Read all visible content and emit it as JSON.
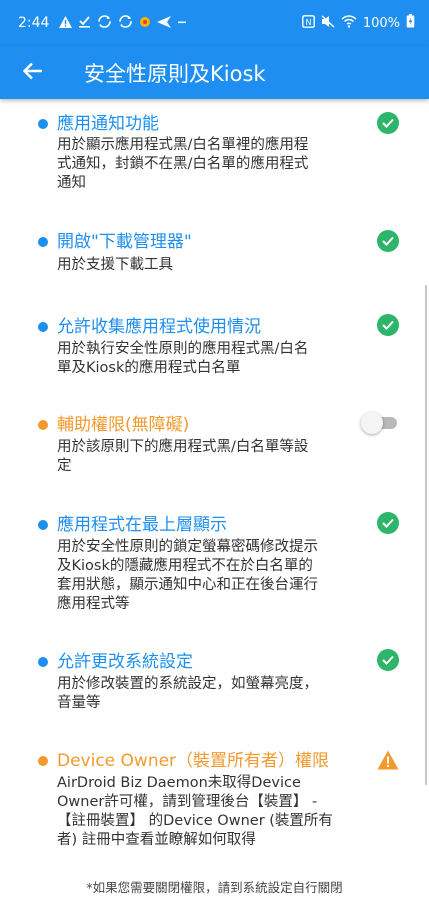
{
  "status_bar": {
    "time": "2:44",
    "battery": "100%",
    "left_icons": [
      "warning-icon",
      "download-done-icon",
      "sync-icon",
      "sync-icon",
      "app-notification-icon",
      "send-icon",
      "dash-icon"
    ],
    "right_icons": [
      "nfc-icon",
      "mute-icon",
      "wifi-icon",
      "battery-icon"
    ]
  },
  "app_bar": {
    "title": "安全性原則及Kiosk"
  },
  "colors": {
    "primary": "#1e8ff0",
    "success": "#2db56a",
    "warning": "#f39a2d",
    "toggle_off": "#b9b9b9"
  },
  "permissions": [
    {
      "title": "應用通知功能",
      "desc_lines": [
        "用於顯示應用程式黑/白名單裡的應用程",
        "式通知，封鎖不在黑/白名單的應用程式",
        "通知"
      ],
      "state": "granted",
      "color": "blue"
    },
    {
      "title": "開啟\"下載管理器\"",
      "desc_lines": [
        "用於支援下載工具"
      ],
      "state": "granted",
      "color": "blue"
    },
    {
      "title": "允許收集應用程式使用情況",
      "desc_lines": [
        "用於執行安全性原則的應用程式黑/白名",
        "單及Kiosk的應用程式白名單"
      ],
      "state": "granted",
      "color": "blue"
    },
    {
      "title": "輔助權限(無障礙)",
      "desc_lines": [
        "用於該原則下的應用程式黑/白名單等設",
        "定"
      ],
      "state": "off",
      "color": "orange"
    },
    {
      "title": "應用程式在最上層顯示",
      "desc_lines": [
        "用於安全性原則的鎖定螢幕密碼修改提示",
        "及Kiosk的隱藏應用程式不在於白名單的",
        "套用狀態，顯示通知中心和正在後台運行",
        "應用程式等"
      ],
      "state": "granted",
      "color": "blue"
    },
    {
      "title": "允許更改系統設定",
      "desc_lines": [
        "用於修改裝置的系統設定，如螢幕亮度，",
        "音量等"
      ],
      "state": "granted",
      "color": "blue"
    },
    {
      "title": "Device Owner（裝置所有者）權限",
      "desc_lines": [
        "AirDroid Biz Daemon未取得Device",
        "Owner許可權，請到管理後台【裝置】 -",
        "【註冊裝置】 的Device Owner (裝置所有",
        "者) 註冊中查看並瞭解如何取得"
      ],
      "state": "warning",
      "color": "orange"
    }
  ],
  "footnote": "*如果您需要關閉權限，請到系統設定自行關閉"
}
